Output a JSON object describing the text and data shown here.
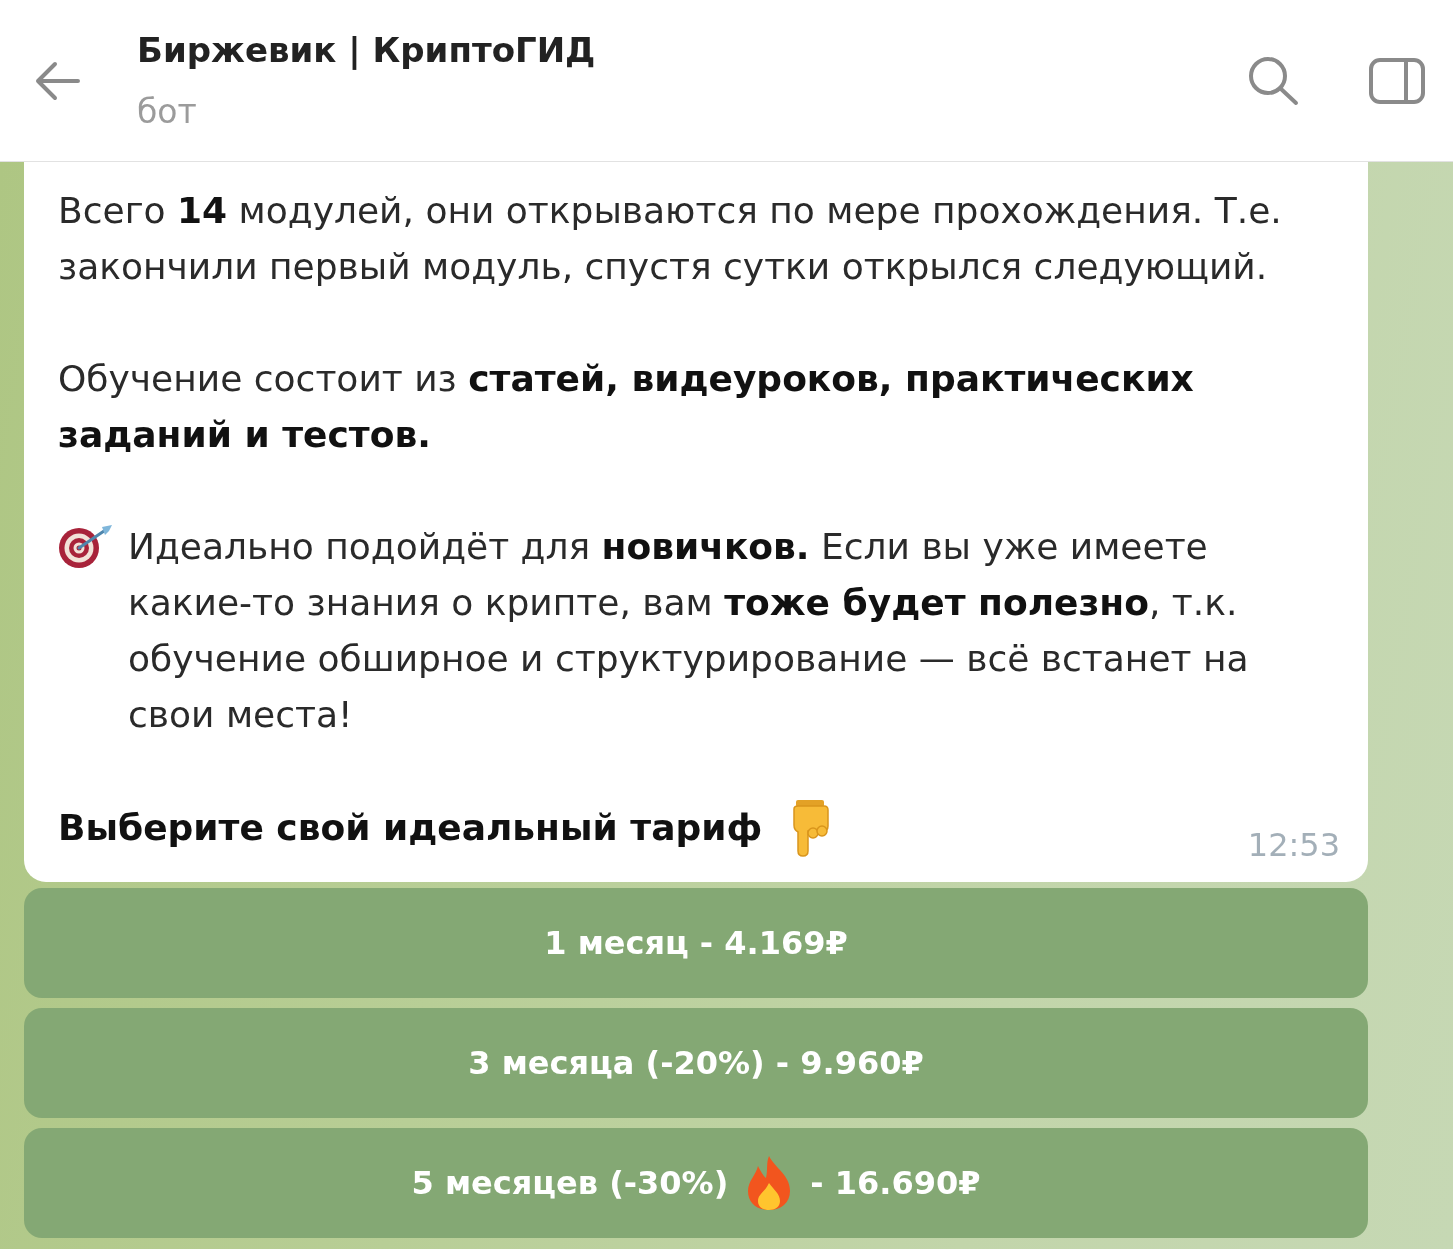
{
  "header": {
    "title": "Биржевик | КриптоГИД",
    "subtitle": "бот"
  },
  "message": {
    "paragraphs": [
      {
        "kind": "plain",
        "text": "Всего **14** модулей, они открываются по мере прохождения. Т.е. закончили первый модуль, спустя сутки открылся следующий."
      },
      {
        "kind": "plain",
        "text": "Обучение состоит из **статей, видеуроков, практических заданий и тестов.**"
      },
      {
        "kind": "tip",
        "text": "Идеально подойдёт для **новичков.** Если вы уже имеете какие-то знания о крипте, вам **тоже будет полезно**, т.к. обучение обширное и структурирование — всё встанет на свои места!"
      },
      {
        "kind": "call_to_action",
        "text": "Выберите свой идеальный тариф"
      }
    ],
    "time": "12:53"
  },
  "buttons": [
    {
      "kind": "plain",
      "label": "1 месяц - 4.169₽"
    },
    {
      "kind": "plain",
      "label": "3 месяца (-20%) - 9.960₽"
    },
    {
      "kind": "featured",
      "label": "5 месяцев (-30%)",
      "suffix": "- 16.690₽"
    }
  ]
}
